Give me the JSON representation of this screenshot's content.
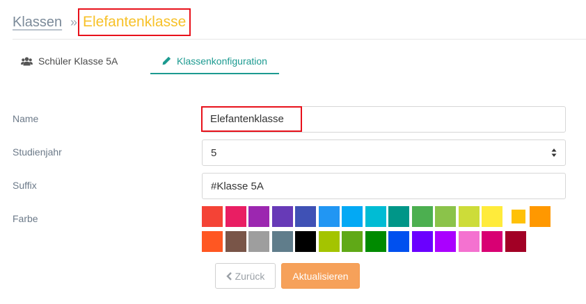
{
  "breadcrumb": {
    "root": "Klassen",
    "separator": "»",
    "current": "Elefantenklasse"
  },
  "tabs": [
    {
      "label": "Schüler Klasse 5A",
      "icon": "users-icon",
      "active": false
    },
    {
      "label": "Klassenkonfiguration",
      "icon": "pencil-icon",
      "active": true
    }
  ],
  "form": {
    "name_label": "Name",
    "name_value": "Elefantenklasse",
    "year_label": "Studienjahr",
    "year_value": "5",
    "suffix_label": "Suffix",
    "suffix_value": "#Klasse 5A",
    "color_label": "Farbe",
    "selected_color": "#ffc107",
    "colors": [
      "#f44336",
      "#e91e63",
      "#9c27b0",
      "#673ab7",
      "#3f51b5",
      "#2196f3",
      "#03a9f4",
      "#00bcd4",
      "#009688",
      "#4caf50",
      "#8bc34a",
      "#cddc39",
      "#ffeb3b",
      "#ffc107",
      "#ff9800",
      "#ff5722",
      "#795548",
      "#9e9e9e",
      "#607d8b",
      "#000000",
      "#a4c400",
      "#60a917",
      "#008a00",
      "#0050ef",
      "#6a00ff",
      "#aa00ff",
      "#f472d0",
      "#d80073",
      "#a20025"
    ]
  },
  "buttons": {
    "back": "Zurück",
    "update": "Aktualisieren"
  },
  "theme": {
    "accent": "#1c9a90",
    "highlight": "#e8101a",
    "title_color": "#f7c128",
    "button_color": "#f6a15a"
  }
}
